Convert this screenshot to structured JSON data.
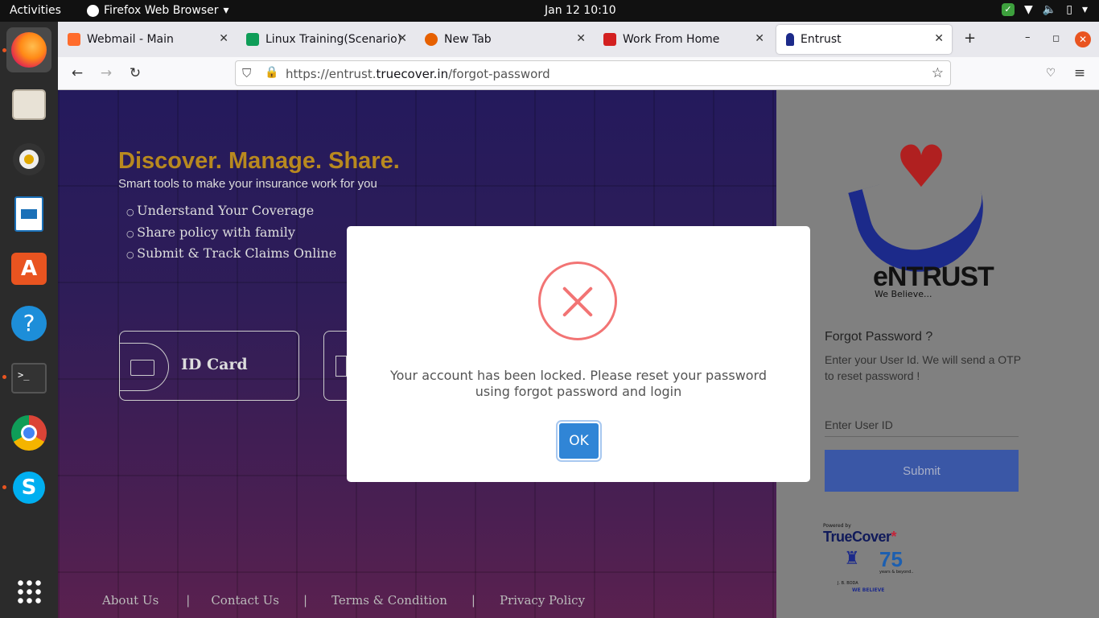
{
  "topbar": {
    "activities": "Activities",
    "app_name": "Firefox Web Browser",
    "clock": "Jan 12  10:10"
  },
  "dock": {
    "items": [
      "firefox",
      "files",
      "rhythmbox",
      "libreoffice-writer",
      "software-center",
      "help",
      "terminal",
      "chrome",
      "skype",
      "show-applications"
    ]
  },
  "browser": {
    "tabs": [
      {
        "label": "Webmail - Main",
        "icon": "cpanel-icon",
        "color": "#ff6c2c"
      },
      {
        "label": "Linux Training(Scenario)",
        "icon": "sheets-icon",
        "color": "#0f9d58"
      },
      {
        "label": "New Tab",
        "icon": "firefox-icon",
        "color": "#e66000"
      },
      {
        "label": "Work From Home",
        "icon": "ns-icon",
        "color": "#d32020"
      },
      {
        "label": "Entrust",
        "icon": "entrust-icon",
        "color": "#1c2a8a"
      }
    ],
    "url_prefix": "https://entrust.",
    "url_domain": "truecover.in",
    "url_path": "/forgot-password"
  },
  "hero": {
    "headline": "Discover. Manage. Share.",
    "subheadline": "Smart tools to make your insurance work for you",
    "bullets": [
      "Understand Your Coverage",
      "Share policy with family",
      "Submit & Track Claims Online"
    ],
    "card_label": "ID Card",
    "footer": [
      "About Us",
      "|",
      "Contact Us",
      "|",
      "Terms & Condition",
      "|",
      "Privacy Policy"
    ]
  },
  "side": {
    "logo_name": "eNTRUST",
    "logo_tag": "We Believe...",
    "title": "Forgot Password ?",
    "desc": "Enter your User Id. We will send a OTP to reset password !",
    "input_placeholder": "Enter User ID",
    "submit_label": "Submit",
    "powered_by": "Powered by",
    "truecover": "TrueCover",
    "truecover_star": "*",
    "jb_boda": "J. B. BODA",
    "years": "75",
    "years_sub": "years & beyond..",
    "we_believe": "WE BELIEVE"
  },
  "modal": {
    "message": "Your account has been locked. Please reset your password using forgot password and login",
    "ok_label": "OK",
    "icon": "error-x-icon",
    "icon_color": "#f27474",
    "button_color": "#3085d6"
  }
}
